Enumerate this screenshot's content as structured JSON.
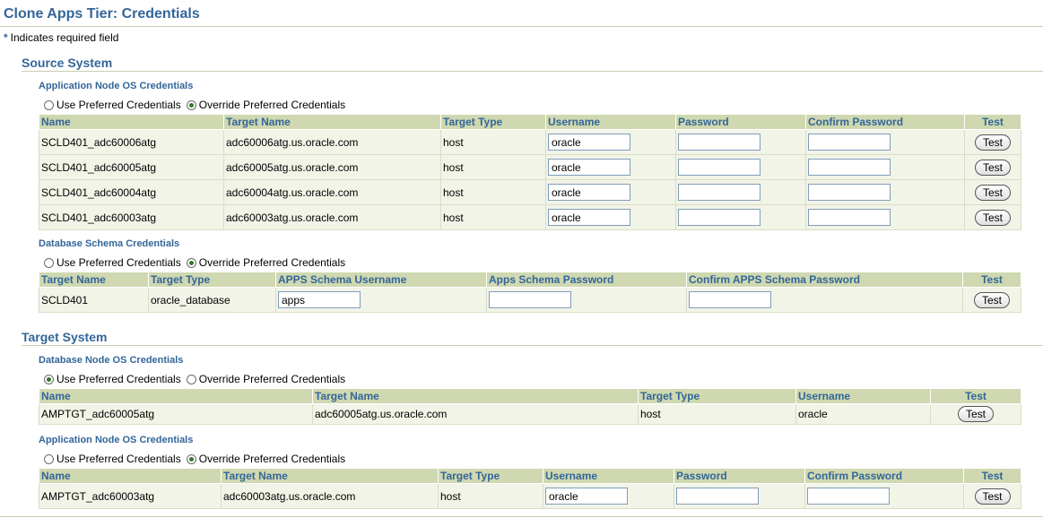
{
  "page": {
    "title": "Clone Apps Tier: Credentials",
    "required_star": "*",
    "required_note": "Indicates required field"
  },
  "source": {
    "title": "Source System",
    "app_node": {
      "title": "Application Node OS Credentials",
      "radio_pref": "Use Preferred Credentials",
      "radio_override": "Override Preferred Credentials",
      "selected": "override",
      "headers": [
        "Name",
        "Target Name",
        "Target Type",
        "Username",
        "Password",
        "Confirm Password",
        "Test"
      ],
      "rows": [
        {
          "name": "SCLD401_adc60006atg",
          "target": "adc60006atg.us.oracle.com",
          "type": "host",
          "username": "oracle",
          "test": "Test"
        },
        {
          "name": "SCLD401_adc60005atg",
          "target": "adc60005atg.us.oracle.com",
          "type": "host",
          "username": "oracle",
          "test": "Test"
        },
        {
          "name": "SCLD401_adc60004atg",
          "target": "adc60004atg.us.oracle.com",
          "type": "host",
          "username": "oracle",
          "test": "Test"
        },
        {
          "name": "SCLD401_adc60003atg",
          "target": "adc60003atg.us.oracle.com",
          "type": "host",
          "username": "oracle",
          "test": "Test"
        }
      ]
    },
    "db_schema": {
      "title": "Database Schema Credentials",
      "radio_pref": "Use Preferred Credentials",
      "radio_override": "Override Preferred Credentials",
      "selected": "override",
      "headers": [
        "Target Name",
        "Target Type",
        "APPS Schema Username",
        "Apps Schema Password",
        "Confirm APPS Schema Password",
        "Test"
      ],
      "row": {
        "target": "SCLD401",
        "type": "oracle_database",
        "username": "apps",
        "test": "Test"
      }
    }
  },
  "target": {
    "title": "Target System",
    "db_node": {
      "title": "Database Node OS Credentials",
      "radio_pref": "Use Preferred Credentials",
      "radio_override": "Override Preferred Credentials",
      "selected": "preferred",
      "headers": [
        "Name",
        "Target Name",
        "Target Type",
        "Username",
        "Test"
      ],
      "row": {
        "name": "AMPTGT_adc60005atg",
        "target": "adc60005atg.us.oracle.com",
        "type": "host",
        "username": "oracle",
        "test": "Test"
      }
    },
    "app_node": {
      "title": "Application Node OS Credentials",
      "radio_pref": "Use Preferred Credentials",
      "radio_override": "Override Preferred Credentials",
      "selected": "override",
      "headers": [
        "Name",
        "Target Name",
        "Target Type",
        "Username",
        "Password",
        "Confirm Password",
        "Test"
      ],
      "row": {
        "name": "AMPTGT_adc60003atg",
        "target": "adc60003atg.us.oracle.com",
        "type": "host",
        "username": "oracle",
        "test": "Test"
      }
    }
  }
}
